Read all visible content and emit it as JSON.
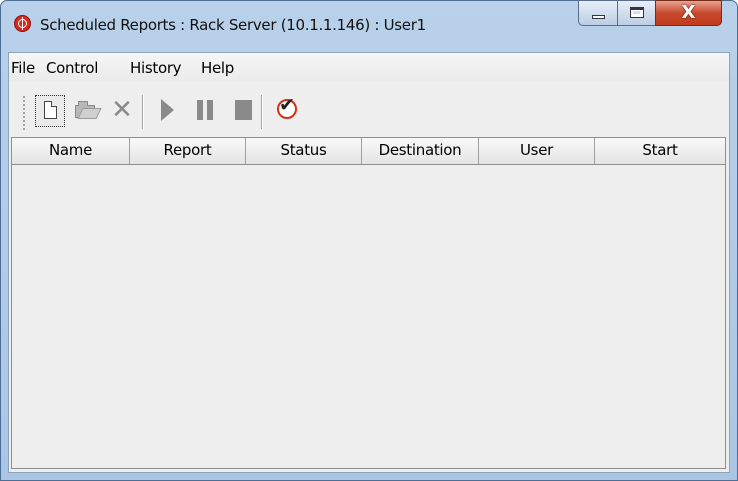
{
  "window": {
    "title": "Scheduled Reports : Rack Server (10.1.1.146) : User1",
    "icon": "app-globe-icon",
    "controls": {
      "minimize_icon": "minimize-icon",
      "maximize_icon": "maximize-icon",
      "close_label": "X"
    }
  },
  "menu": {
    "items": [
      "File",
      "Control",
      "History",
      "Help"
    ]
  },
  "toolbar": {
    "buttons": [
      {
        "icon": "new-document-icon",
        "enabled": true
      },
      {
        "icon": "open-folder-icon",
        "enabled": false
      },
      {
        "icon": "delete-icon",
        "enabled": false
      },
      {
        "icon": "play-icon",
        "enabled": false
      },
      {
        "icon": "pause-icon",
        "enabled": false
      },
      {
        "icon": "stop-icon",
        "enabled": false
      },
      {
        "icon": "check-icon",
        "enabled": true
      }
    ],
    "delete_glyph": "✕",
    "check_glyph": "✔"
  },
  "table": {
    "columns": [
      "Name",
      "Report",
      "Status",
      "Destination",
      "User",
      "Start"
    ],
    "rows": []
  },
  "colors": {
    "frame": "#b9d1ea",
    "close_button": "#c74a2e",
    "app_icon": "#d62a1f",
    "client_bg": "#eeeeee"
  }
}
